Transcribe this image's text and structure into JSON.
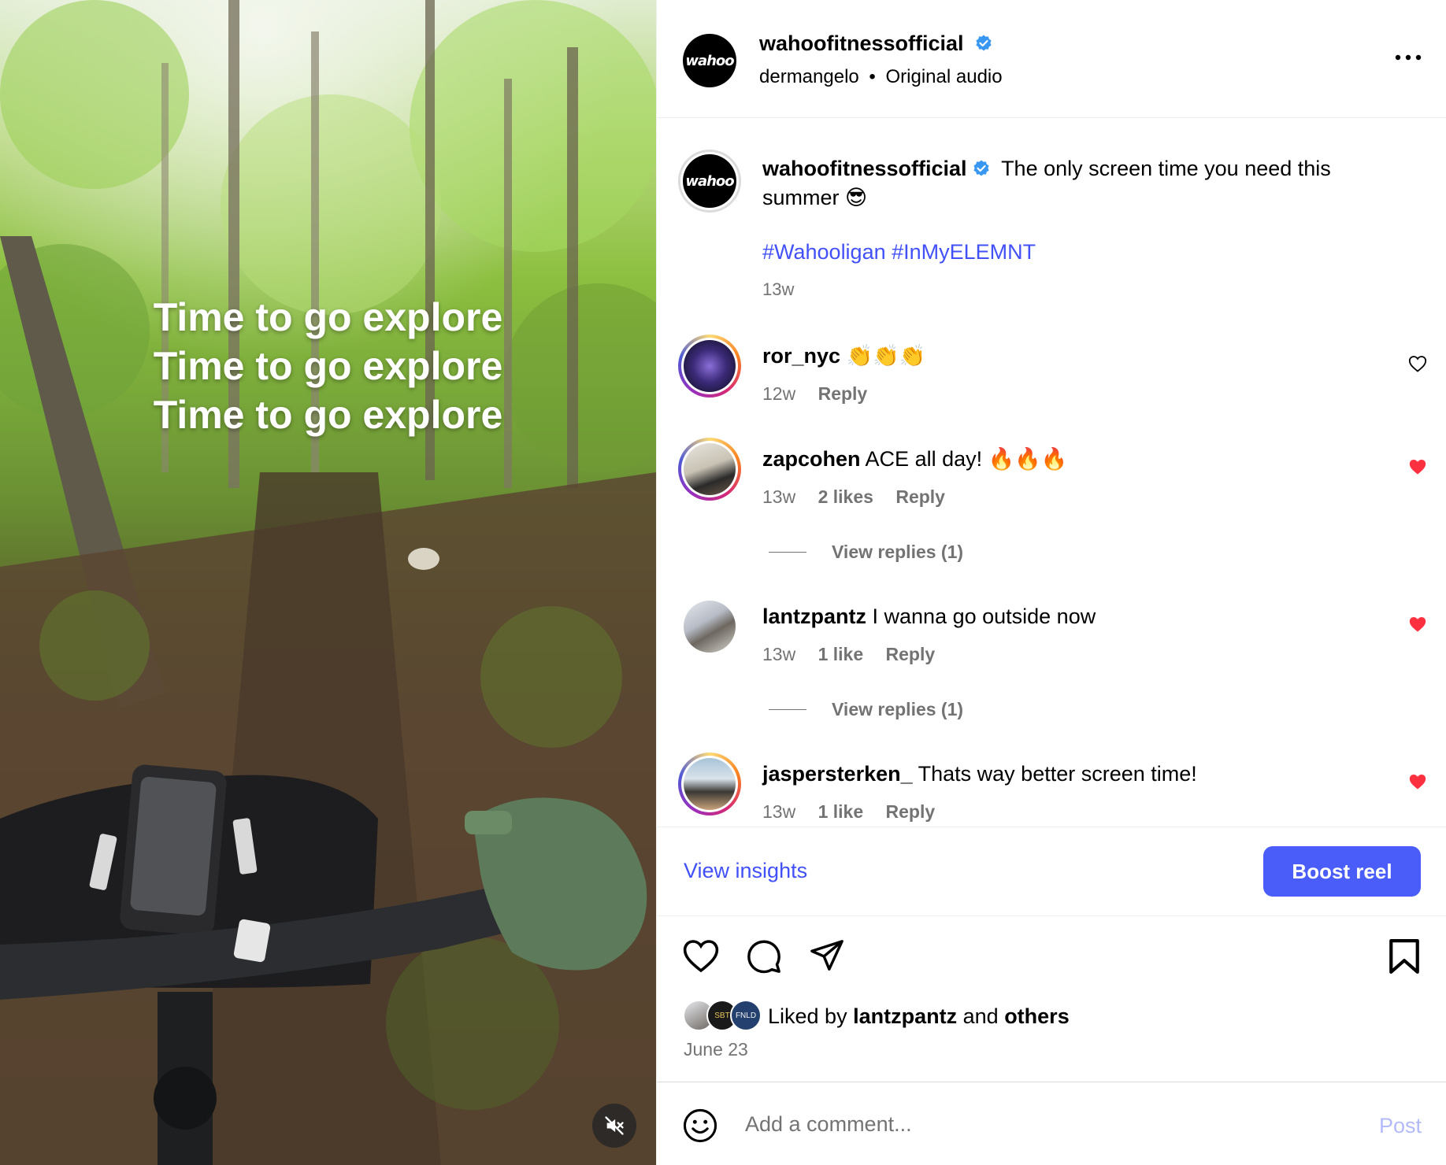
{
  "video": {
    "overlay_lines": [
      "Time to go explore",
      "Time to go explore",
      "Time to go explore"
    ]
  },
  "header": {
    "avatar_text": "wahoo",
    "username": "wahoofitnessofficial",
    "audio_author": "dermangelo",
    "separator": "•",
    "audio_label": "Original audio",
    "more_icon": "more-horizontal-icon"
  },
  "caption": {
    "avatar_text": "wahoo",
    "username": "wahoofitnessofficial",
    "text": "The only screen time you need this summer 😎",
    "hashtags": "#Wahooligan #InMyELEMNT",
    "time": "13w"
  },
  "comments": [
    {
      "username": "ror_nyc",
      "text": "👏👏👏",
      "time": "12w",
      "likes": "",
      "reply": "Reply",
      "liked": false
    },
    {
      "username": "zapcohen",
      "text": "ACE all day! 🔥🔥🔥",
      "time": "13w",
      "likes": "2 likes",
      "reply": "Reply",
      "liked": true
    },
    {
      "username": "lantzpantz",
      "text": "I wanna go outside now",
      "time": "13w",
      "likes": "1 like",
      "reply": "Reply",
      "liked": true
    },
    {
      "username": "jaspersterken_",
      "text": "Thats way better screen time!",
      "time": "13w",
      "likes": "1 like",
      "reply": "Reply",
      "liked": true
    }
  ],
  "view_replies": [
    "View replies (1)",
    "View replies (1)"
  ],
  "insights": {
    "view_label": "View insights",
    "boost_label": "Boost reel"
  },
  "likes": {
    "prefix": "Liked by",
    "user": "lantzpantz",
    "and": "and",
    "others": "others",
    "avatar_labels": [
      "SBT",
      "FNLD"
    ],
    "date": "June 23"
  },
  "add_comment": {
    "placeholder": "Add a comment...",
    "post_label": "Post"
  },
  "colors": {
    "link_blue": "#4150f7",
    "boost_bg": "#4a5df9",
    "heart_red": "#ff3040",
    "muted": "#737373"
  }
}
